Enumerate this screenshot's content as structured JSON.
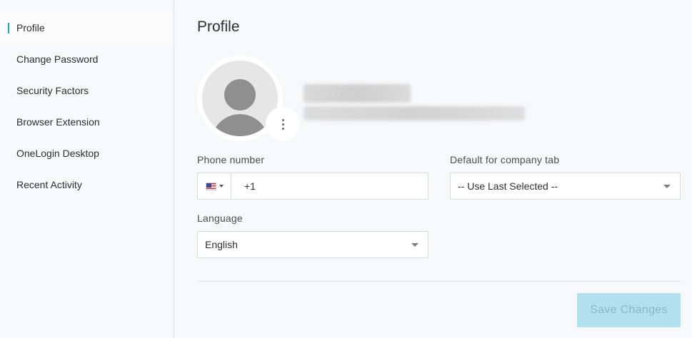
{
  "sidebar": {
    "items": [
      {
        "label": "Profile",
        "active": true
      },
      {
        "label": "Change Password"
      },
      {
        "label": "Security Factors"
      },
      {
        "label": "Browser Extension"
      },
      {
        "label": "OneLogin Desktop"
      },
      {
        "label": "Recent Activity"
      }
    ]
  },
  "main": {
    "title": "Profile",
    "avatar": {
      "icon": "user-avatar-icon",
      "menu_icon": "more-vertical-icon"
    },
    "phone": {
      "label": "Phone number",
      "country_flag": "us-flag-icon",
      "value": "+1"
    },
    "default_tab": {
      "label": "Default for company tab",
      "value": "-- Use Last Selected --"
    },
    "language": {
      "label": "Language",
      "value": "English"
    },
    "save_label": "Save Changes"
  },
  "colors": {
    "accent": "#1ca3c9",
    "save_button_bg": "#b3e0ef",
    "save_button_text": "#8ab8c8"
  }
}
